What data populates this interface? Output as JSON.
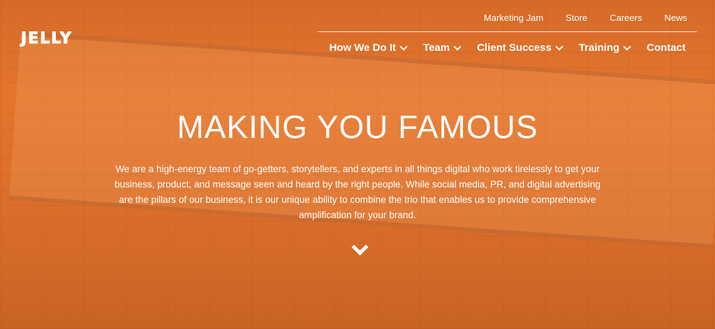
{
  "brand": {
    "logo_text": "JELLY"
  },
  "top_nav": [
    {
      "label": "Marketing Jam"
    },
    {
      "label": "Store"
    },
    {
      "label": "Careers"
    },
    {
      "label": "News"
    }
  ],
  "main_nav": [
    {
      "label": "How We Do It",
      "has_dropdown": true
    },
    {
      "label": "Team",
      "has_dropdown": true
    },
    {
      "label": "Client Success",
      "has_dropdown": true
    },
    {
      "label": "Training",
      "has_dropdown": true
    },
    {
      "label": "Contact",
      "has_dropdown": false
    }
  ],
  "hero": {
    "headline": "MAKING YOU FAMOUS",
    "intro": "We are a high-energy team of go-getters, storytellers, and experts in all things digital who work tirelessly to get your business, product, and message seen and heard by the right people. While social media, PR, and digital advertising are the pillars of our business, it is our unique ability to combine the trio that enables us to provide comprehensive amplification for your brand.",
    "scroll_icon": "chevron-down-icon"
  },
  "colors": {
    "overlay": "#e8782c",
    "text": "#ffffff"
  }
}
